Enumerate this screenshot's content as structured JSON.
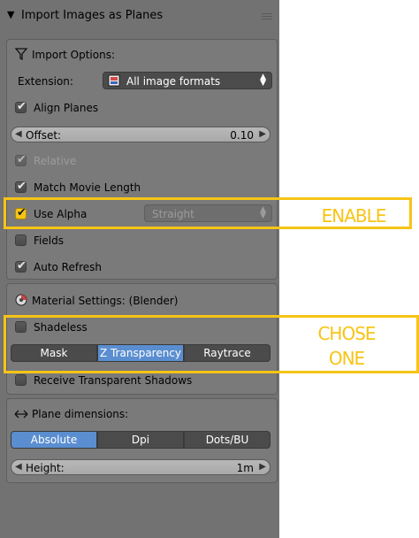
{
  "panel": {
    "title": "Import Images as Planes"
  },
  "import_options": {
    "title": "Import Options:",
    "extension_label": "Extension:",
    "extension_value": "All image formats",
    "align_planes": {
      "label": "Align Planes",
      "checked": true
    },
    "offset": {
      "label": "Offset:",
      "value": "0.10"
    },
    "relative": {
      "label": "Relative",
      "checked": true,
      "disabled": true
    },
    "match_movie_length": {
      "label": "Match Movie Length",
      "checked": true
    },
    "use_alpha": {
      "label": "Use Alpha",
      "checked": true
    },
    "alpha_mode": "Straight",
    "fields": {
      "label": "Fields",
      "checked": false
    },
    "auto_refresh": {
      "label": "Auto Refresh",
      "checked": true
    }
  },
  "material_settings": {
    "title": "Material Settings: (Blender)",
    "shadeless": {
      "label": "Shadeless",
      "checked": false
    },
    "transparency_modes": [
      "Mask",
      "Z Transparency",
      "Raytrace"
    ],
    "transparency_active": "Z Transparency",
    "receive_shadows": {
      "label": "Receive Transparent Shadows",
      "checked": false
    }
  },
  "plane_dimensions": {
    "title": "Plane dimensions:",
    "modes": [
      "Absolute",
      "Dpi",
      "Dots/BU"
    ],
    "mode_active": "Absolute",
    "height": {
      "label": "Height:",
      "value": "1m"
    }
  },
  "annotations": {
    "enable": "ENABLE",
    "chose_line1": "CHOSE",
    "chose_line2": "ONE",
    "highlight_color": "#f7c416"
  }
}
